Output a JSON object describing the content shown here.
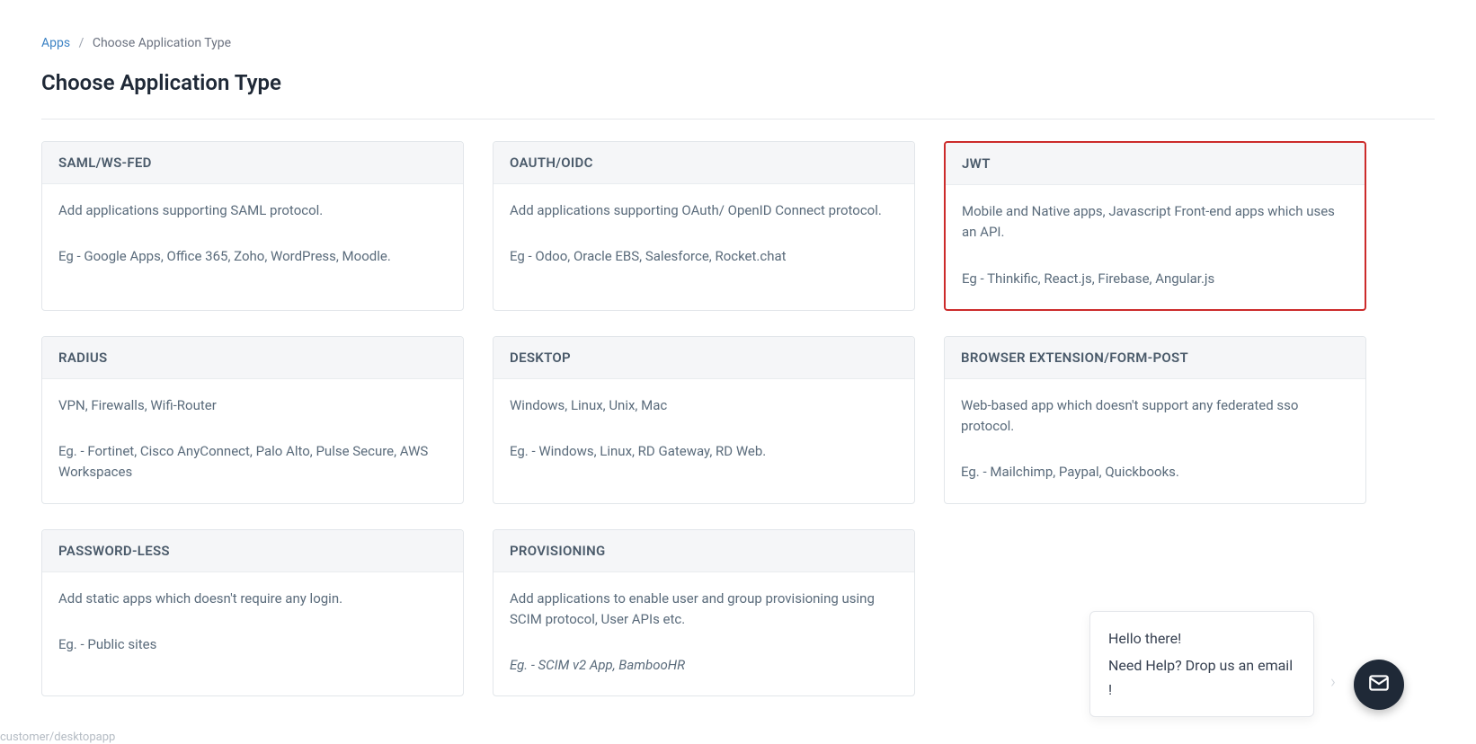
{
  "breadcrumb": {
    "root": "Apps",
    "current": "Choose Application Type"
  },
  "page_title": "Choose Application Type",
  "cards": [
    {
      "title": "SAML/WS-FED",
      "desc": "Add applications supporting SAML protocol.",
      "examples": "Eg - Google Apps, Office 365, Zoho, WordPress, Moodle.",
      "highlighted": false,
      "italic": false
    },
    {
      "title": "OAUTH/OIDC",
      "desc": "Add applications supporting OAuth/ OpenID Connect protocol.",
      "examples": "Eg - Odoo, Oracle EBS, Salesforce, Rocket.chat",
      "highlighted": false,
      "italic": false
    },
    {
      "title": "JWT",
      "desc": "Mobile and Native apps, Javascript Front-end apps which uses an API.",
      "examples": "Eg - Thinkific, React.js, Firebase, Angular.js",
      "highlighted": true,
      "italic": false
    },
    {
      "title": "RADIUS",
      "desc": "VPN, Firewalls, Wifi-Router",
      "examples": "Eg. - Fortinet, Cisco AnyConnect, Palo Alto, Pulse Secure, AWS Workspaces",
      "highlighted": false,
      "italic": false
    },
    {
      "title": "DESKTOP",
      "desc": "Windows, Linux, Unix, Mac",
      "examples": "Eg. - Windows, Linux, RD Gateway, RD Web.",
      "highlighted": false,
      "italic": false
    },
    {
      "title": "BROWSER EXTENSION/FORM-POST",
      "desc": "Web-based app which doesn't support any federated sso protocol.",
      "examples": "Eg. - Mailchimp, Paypal, Quickbooks.",
      "highlighted": false,
      "italic": false
    },
    {
      "title": "PASSWORD-LESS",
      "desc": "Add static apps which doesn't require any login.",
      "examples": "Eg. - Public sites",
      "highlighted": false,
      "italic": false
    },
    {
      "title": "PROVISIONING",
      "desc": "Add applications to enable user and group provisioning using SCIM protocol, User APIs etc.",
      "examples": "Eg. - SCIM v2 App, BambooHR",
      "highlighted": false,
      "italic": true
    }
  ],
  "chat": {
    "line1": "Hello there!",
    "line2": "Need Help? Drop us an email !"
  },
  "footer_hint": "customer/desktopapp"
}
